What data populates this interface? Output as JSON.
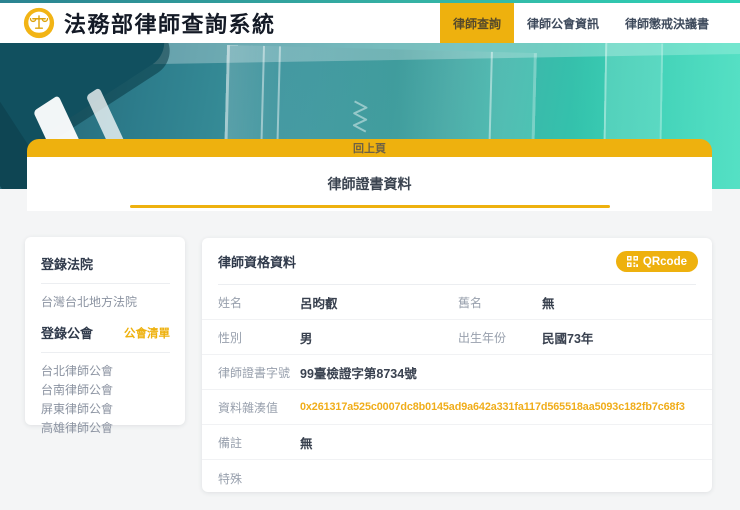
{
  "colors": {
    "accent_yellow": "#eeb10e",
    "teal_dark": "#235f70",
    "teal_bright": "#2ed4b6",
    "hash_orange": "#f0ad1a"
  },
  "header": {
    "brand_title": "法務部律師查詢系統",
    "nav": [
      {
        "label": "律師查詢",
        "active": true
      },
      {
        "label": "律師公會資訊",
        "active": false
      },
      {
        "label": "律師懲戒決議書",
        "active": false
      }
    ]
  },
  "hero": {
    "back_label": "回上頁",
    "page_title": "律師證書資料"
  },
  "sidebar": {
    "court_heading": "登錄法院",
    "court_name": "台灣台北地方法院",
    "assoc_heading": "登錄公會",
    "assoc_list_link": "公會清單",
    "associations": [
      {
        "name": "台北律師公會"
      },
      {
        "name": "台南律師公會"
      },
      {
        "name": "屏東律師公會"
      },
      {
        "name": "高雄律師公會"
      }
    ]
  },
  "detail": {
    "heading": "律師資格資料",
    "qrcode_button": "QRcode",
    "rows": [
      {
        "cells": [
          {
            "label": "姓名",
            "value": "呂昀叡"
          },
          {
            "label": "舊名",
            "value": "無"
          }
        ]
      },
      {
        "cells": [
          {
            "label": "性別",
            "value": "男"
          },
          {
            "label": "出生年份",
            "value": "民國73年"
          }
        ]
      },
      {
        "cells": [
          {
            "label": "律師證書字號",
            "value": "99臺檢證字第8734號"
          }
        ]
      },
      {
        "cells": [
          {
            "label": "資料雜湊值",
            "value": "0x261317a525c0007dc8b0145ad9a642a331fa117d565518aa5093c182fb7c68f3"
          }
        ]
      },
      {
        "cells": [
          {
            "label": "備註",
            "value": "無"
          }
        ]
      },
      {
        "cells": [
          {
            "label": "特殊",
            "value": ""
          }
        ]
      }
    ]
  }
}
